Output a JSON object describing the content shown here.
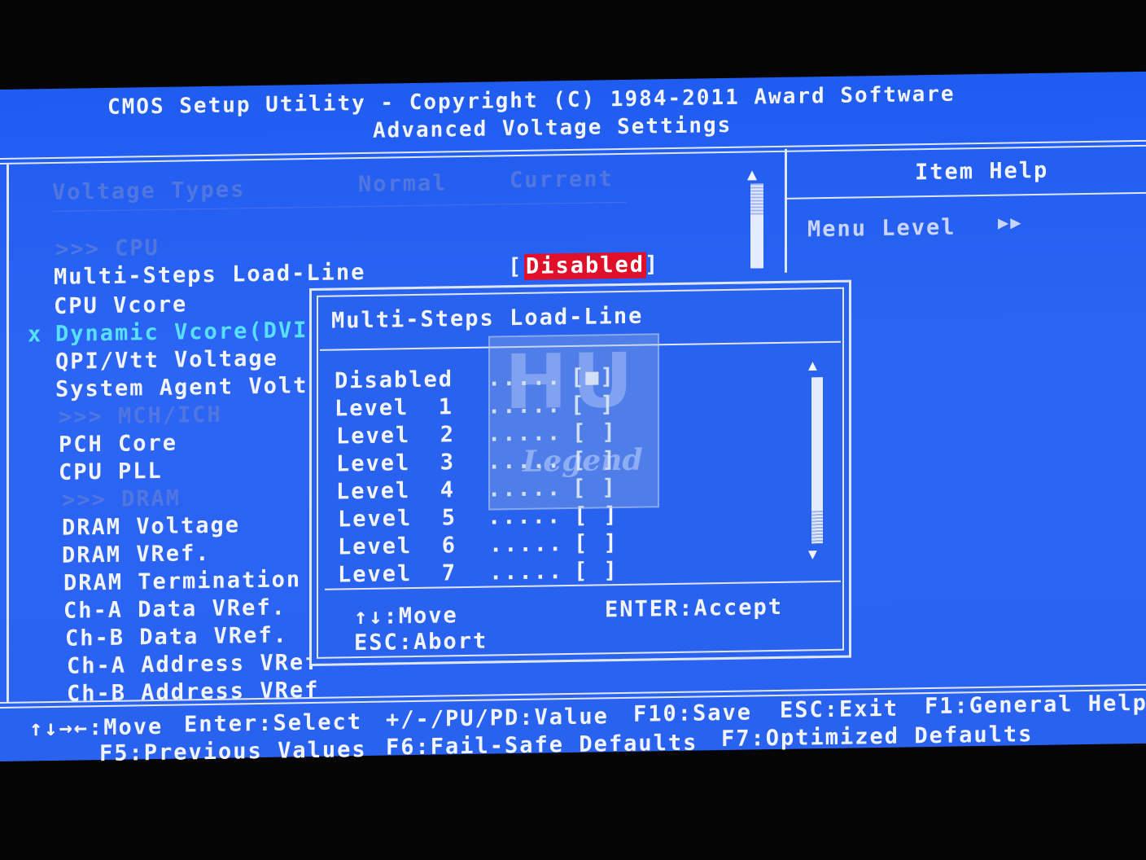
{
  "header": {
    "title": "CMOS Setup Utility - Copyright (C) 1984-2011 Award Software",
    "subtitle": "Advanced Voltage Settings"
  },
  "columns": {
    "types": "Voltage Types",
    "normal": "Normal",
    "current": "Current"
  },
  "left_items": [
    {
      "label": ">>> CPU"
    },
    {
      "label": "Multi-Steps Load-Line",
      "value_prefix": "[",
      "value": "Disabled",
      "value_suffix": "]"
    },
    {
      "label": "CPU Vcore"
    },
    {
      "prefix": "x",
      "label": "Dynamic Vcore(DVI"
    },
    {
      "label": "QPI/Vtt Voltage"
    },
    {
      "label": "System Agent Volt"
    },
    {
      "label": ">>> MCH/ICH"
    },
    {
      "label": "PCH Core"
    },
    {
      "label": "CPU PLL"
    },
    {
      "label": ">>> DRAM"
    },
    {
      "label": "DRAM Voltage"
    },
    {
      "label": "DRAM VRef."
    },
    {
      "label": "DRAM Termination"
    },
    {
      "label": "Ch-A Data VRef."
    },
    {
      "label": "Ch-B Data VRef."
    },
    {
      "label": "Ch-A Address VRef"
    },
    {
      "label": "Ch-B Address VRef"
    }
  ],
  "help_panel": {
    "title": "Item Help",
    "menu_level": "Menu Level",
    "arrows": "▶▶"
  },
  "popup": {
    "title": "Multi-Steps Load-Line",
    "dots": ".....",
    "options": [
      {
        "label": "Disabled",
        "box": "[■]"
      },
      {
        "label": "Level  1",
        "box": "[ ]"
      },
      {
        "label": "Level  2",
        "box": "[ ]"
      },
      {
        "label": "Level  3",
        "box": "[ ]"
      },
      {
        "label": "Level  4",
        "box": "[ ]"
      },
      {
        "label": "Level  5",
        "box": "[ ]"
      },
      {
        "label": "Level  6",
        "box": "[ ]"
      },
      {
        "label": "Level  7",
        "box": "[ ]"
      }
    ],
    "keys": {
      "move": "↑↓:Move",
      "accept": "ENTER:Accept",
      "abort": "ESC:Abort"
    }
  },
  "watermark": {
    "big": "HU",
    "small": "Legend"
  },
  "footer": {
    "line1": [
      "↑↓→←:Move",
      "Enter:Select",
      "+/-/PU/PD:Value",
      "F10:Save",
      "ESC:Exit",
      "F1:General Help"
    ],
    "line2": [
      "F5:Previous Values",
      "F6:Fail-Safe Defaults",
      "F7:Optimized Defaults"
    ]
  },
  "scroll": {
    "up": "▲",
    "down": "▼"
  }
}
